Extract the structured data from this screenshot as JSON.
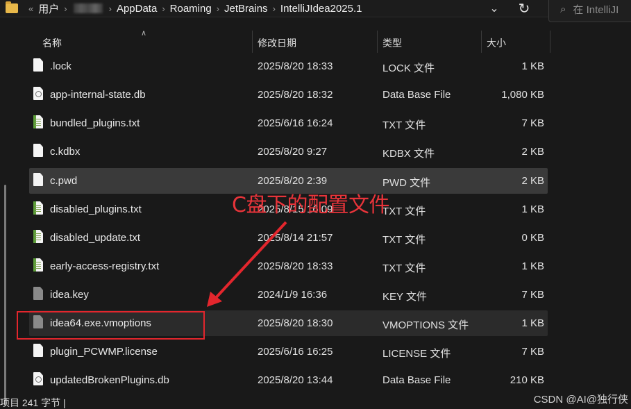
{
  "address_bar": {
    "overflow_glyph": "«",
    "crumbs": [
      "用户",
      "AppData",
      "Roaming",
      "JetBrains",
      "IntelliJIdea2025.1"
    ],
    "dropdown_glyph": "⌄",
    "refresh_glyph": "↻"
  },
  "search": {
    "placeholder": "在 IntelliJI"
  },
  "columns": {
    "name": "名称",
    "date": "修改日期",
    "type": "类型",
    "size": "大小"
  },
  "files": [
    {
      "name": ".lock",
      "date": "2025/8/20 18:33",
      "type": "LOCK 文件",
      "size": "1 KB",
      "icon": "file-icon"
    },
    {
      "name": "app-internal-state.db",
      "date": "2025/8/20 18:32",
      "type": "Data Base File",
      "size": "1,080 KB",
      "icon": "db-file-icon"
    },
    {
      "name": "bundled_plugins.txt",
      "date": "2025/6/16 16:24",
      "type": "TXT 文件",
      "size": "7 KB",
      "icon": "txt-file-icon"
    },
    {
      "name": "c.kdbx",
      "date": "2025/8/20 9:27",
      "type": "KDBX 文件",
      "size": "2 KB",
      "icon": "file-icon"
    },
    {
      "name": "c.pwd",
      "date": "2025/8/20 2:39",
      "type": "PWD 文件",
      "size": "2 KB",
      "icon": "file-icon"
    },
    {
      "name": "disabled_plugins.txt",
      "date": "2025/8/15 16:09",
      "type": "TXT 文件",
      "size": "1 KB",
      "icon": "txt-file-icon"
    },
    {
      "name": "disabled_update.txt",
      "date": "2025/8/14 21:57",
      "type": "TXT 文件",
      "size": "0 KB",
      "icon": "txt-file-icon"
    },
    {
      "name": "early-access-registry.txt",
      "date": "2025/8/20 18:33",
      "type": "TXT 文件",
      "size": "1 KB",
      "icon": "txt-file-icon"
    },
    {
      "name": "idea.key",
      "date": "2024/1/9 16:36",
      "type": "KEY 文件",
      "size": "7 KB",
      "icon": "key-file-icon"
    },
    {
      "name": "idea64.exe.vmoptions",
      "date": "2025/8/20 18:30",
      "type": "VMOPTIONS 文件",
      "size": "1 KB",
      "icon": "vmoptions-file-icon"
    },
    {
      "name": "plugin_PCWMP.license",
      "date": "2025/6/16 16:25",
      "type": "LICENSE 文件",
      "size": "7 KB",
      "icon": "file-icon"
    },
    {
      "name": "updatedBrokenPlugins.db",
      "date": "2025/8/20 13:44",
      "type": "Data Base File",
      "size": "210 KB",
      "icon": "db-file-icon"
    }
  ],
  "status": {
    "text": "项目   241 字节  |"
  },
  "annotation": {
    "label": "C盘下的配置文件",
    "color": "#e3262d"
  },
  "watermark": "CSDN @AI@独行侠"
}
